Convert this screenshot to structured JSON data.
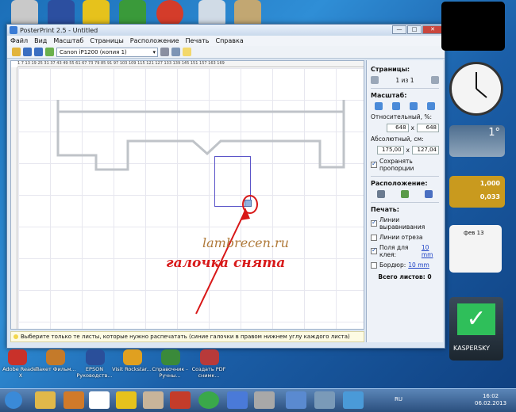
{
  "window": {
    "title": "PosterPrint 2.5 - Untitled"
  },
  "menu": [
    "Файл",
    "Вид",
    "Масштаб",
    "Страницы",
    "Расположение",
    "Печать",
    "Справка"
  ],
  "toolbar": {
    "printer": "Canon iP1200 (копия 1)"
  },
  "ruler": {
    "top_marks": "1  7  13  19  25  31  37  43  49  55  61  67  73  79  85  91  97  103 109 115 121 127 133 139 145 151 157 163 169"
  },
  "panel": {
    "pages_title": "Страницы:",
    "pages_value": "1 из 1",
    "scale_title": "Масштаб:",
    "relative_label": "Относительный, %:",
    "relative_w": "648",
    "relative_h": "648",
    "x_sep": "x",
    "absolute_label": "Абсолютный, см:",
    "absolute_w": "175,00",
    "absolute_h": "127,04",
    "keep_proportions": "Сохранять пропорции",
    "layout_title": "Расположение:",
    "print_title": "Печать:",
    "align_lines": "Линии выравнивания",
    "cut_lines": "Линии отреза",
    "glue_fields": "Поля для клея:",
    "glue_value": "10 mm",
    "border": "Бордюр:",
    "border_value": "10 mm",
    "total_sheets": "Всего листов: 0"
  },
  "hint": "Выберите только те листы, которые нужно распечатать (синие галочки в правом нижнем углу каждого листа)",
  "overlay": {
    "watermark": "lambrecen.ru",
    "caption": "галочка снята"
  },
  "desktop_labels": [
    "Adobe Reader X",
    "Пакет Фильм...",
    "EPSON Руководств...",
    "Visit Rockstar...",
    "Справочник - Ручны...",
    "Создать PDF снимк..."
  ],
  "gadgets": {
    "temperature": "1°",
    "currency_1": "1,000",
    "currency_2": "0,033",
    "calendar_month": "фев 13",
    "kaspersky": "KASPERSKY"
  },
  "taskbar": {
    "lang": "RU",
    "time": "16:02",
    "date": "06.02.2013"
  },
  "accent": {
    "selection": "#5b55c9",
    "annotation": "#d81a1a",
    "watermark": "#b07a3a"
  }
}
